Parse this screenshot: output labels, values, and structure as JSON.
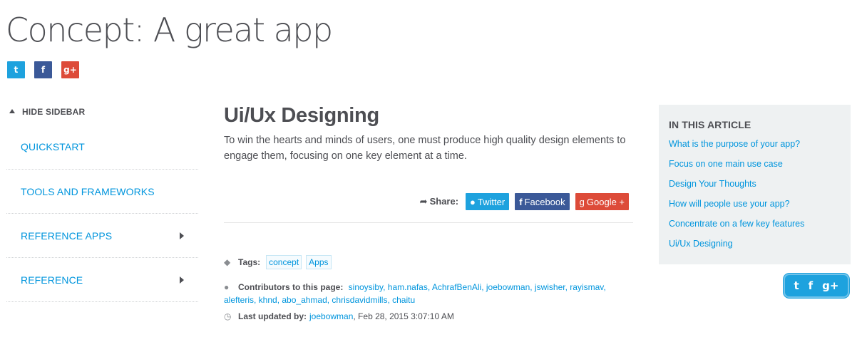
{
  "header": {
    "title": "Concept: A great app",
    "social": {
      "twitter_icon": "t",
      "facebook_icon": "f",
      "google_icon": "g+"
    }
  },
  "sidebar": {
    "toggle_label": "HIDE SIDEBAR",
    "items": [
      {
        "label": "QUICKSTART",
        "has_submenu": false
      },
      {
        "label": "TOOLS AND FRAMEWORKS",
        "has_submenu": false
      },
      {
        "label": "REFERENCE APPS",
        "has_submenu": true
      },
      {
        "label": "REFERENCE",
        "has_submenu": true
      }
    ]
  },
  "main": {
    "heading": "Ui/Ux Designing",
    "intro": "To win the hearts and minds of users, one must produce high quality design elements to engage them, focusing on one key element at a time.",
    "share": {
      "label": "Share:",
      "twitter": "Twitter",
      "facebook": "Facebook",
      "google": "Google +"
    },
    "tags": {
      "label": "Tags:",
      "items": [
        "concept",
        "Apps"
      ]
    },
    "contributors": {
      "label": "Contributors to this page:",
      "list": "sinoysiby, ham.nafas, AchrafBenAli, joebowman, jswisher, rayismav, alefteris, khnd, abo_ahmad, chrisdavidmills, chaitu"
    },
    "last_updated": {
      "label": "Last updated by:",
      "user": "joebowman",
      "date": ", Feb 28, 2015 3:07:10 AM"
    }
  },
  "toc": {
    "title": "IN THIS ARTICLE",
    "items": [
      "What is the purpose of your app?",
      "Focus on one main use case",
      "Design Your Thoughts",
      "How will people use your app?",
      "Concentrate on a few key features",
      "Ui/Ux Designing"
    ]
  },
  "float_share": {
    "twitter_icon": "t",
    "facebook_icon": "f",
    "google_icon": "g+"
  },
  "colors": {
    "link": "#0095dd",
    "text": "#4d4e53",
    "twitter": "#1ea2de",
    "facebook": "#3b5998",
    "google": "#dd4b39",
    "toc_bg": "#eef1f2"
  }
}
